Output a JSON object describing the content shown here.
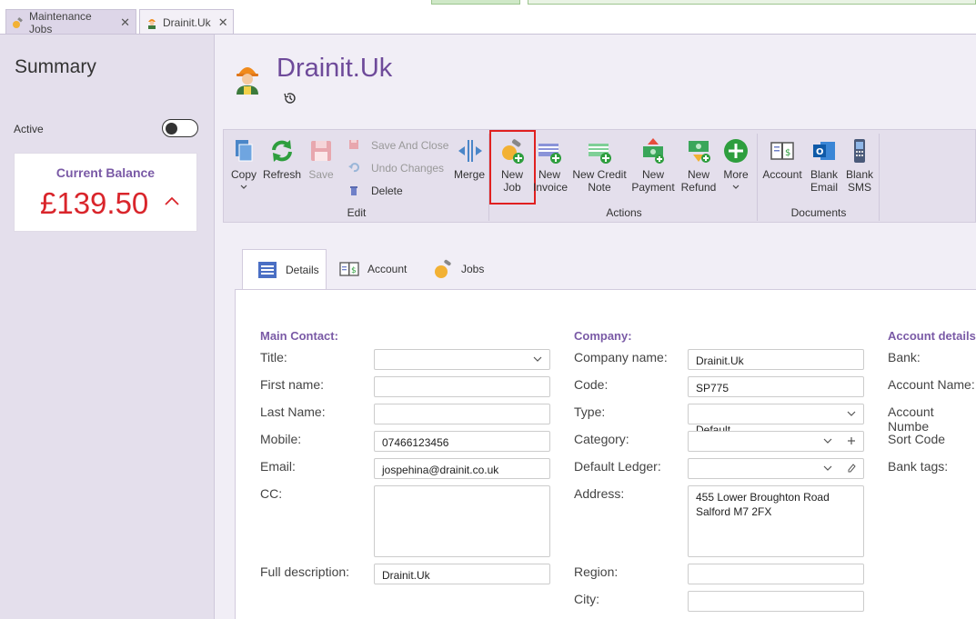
{
  "window": {
    "tabs": [
      {
        "label": "Maintenance Jobs",
        "close": "✕"
      },
      {
        "label": "Drainit.Uk",
        "close": "✕"
      }
    ]
  },
  "summary": {
    "title": "Summary",
    "active_label": "Active",
    "active": false,
    "balance_label": "Current Balance",
    "balance_value": "£139.50",
    "balance_chevron": "^"
  },
  "header": {
    "title": "Drainit.Uk"
  },
  "ribbon": {
    "edit": {
      "copy": "Copy",
      "refresh": "Refresh",
      "save": "Save",
      "save_and_close": "Save And Close",
      "undo_changes": "Undo Changes",
      "delete": "Delete",
      "merge": "Merge",
      "group_label": "Edit"
    },
    "actions": {
      "new_job_1": "New",
      "new_job_2": "Job",
      "new_invoice_1": "New",
      "new_invoice_2": "Invoice",
      "new_credit_1": "New Credit",
      "new_credit_2": "Note",
      "new_payment_1": "New",
      "new_payment_2": "Payment",
      "new_refund_1": "New",
      "new_refund_2": "Refund",
      "more": "More",
      "group_label": "Actions"
    },
    "documents": {
      "account": "Account",
      "blank_email_1": "Blank",
      "blank_email_2": "Email",
      "blank_sms_1": "Blank",
      "blank_sms_2": "SMS",
      "group_label": "Documents"
    },
    "colors": {
      "accent": "#7a5aa6",
      "highlight": "#e02020",
      "green": "#2e9e3e"
    }
  },
  "content_tabs": [
    {
      "label": "Details"
    },
    {
      "label": "Account"
    },
    {
      "label": "Jobs"
    }
  ],
  "form": {
    "main_contact": {
      "heading": "Main Contact:",
      "title_label": "Title:",
      "title_value": "",
      "first_name_label": "First name:",
      "first_name_value": "",
      "last_name_label": "Last Name:",
      "last_name_value": "",
      "mobile_label": "Mobile:",
      "mobile_value": "07466123456",
      "email_label": "Email:",
      "email_value": "jospehina@drainit.co.uk",
      "cc_label": "CC:",
      "cc_value": "",
      "full_description_label": "Full description:",
      "full_description_value": "Drainit.Uk"
    },
    "company": {
      "heading": "Company:",
      "company_name_label": "Company name:",
      "company_name_value": "Drainit.Uk",
      "code_label": "Code:",
      "code_value": "SP775",
      "type_label": "Type:",
      "type_value": "Default",
      "category_label": "Category:",
      "category_value": "",
      "default_ledger_label": "Default Ledger:",
      "default_ledger_value": "",
      "address_label": "Address:",
      "address_value": "455 Lower Broughton Road\nSalford M7 2FX",
      "region_label": "Region:",
      "region_value": "",
      "city_label": "City:",
      "city_value": ""
    },
    "account_details": {
      "heading": "Account details",
      "bank_label": "Bank:",
      "account_name_label": "Account Name:",
      "account_number_label": "Account Numbe",
      "sort_code_label": "Sort Code",
      "bank_tags_label": "Bank tags:"
    }
  }
}
